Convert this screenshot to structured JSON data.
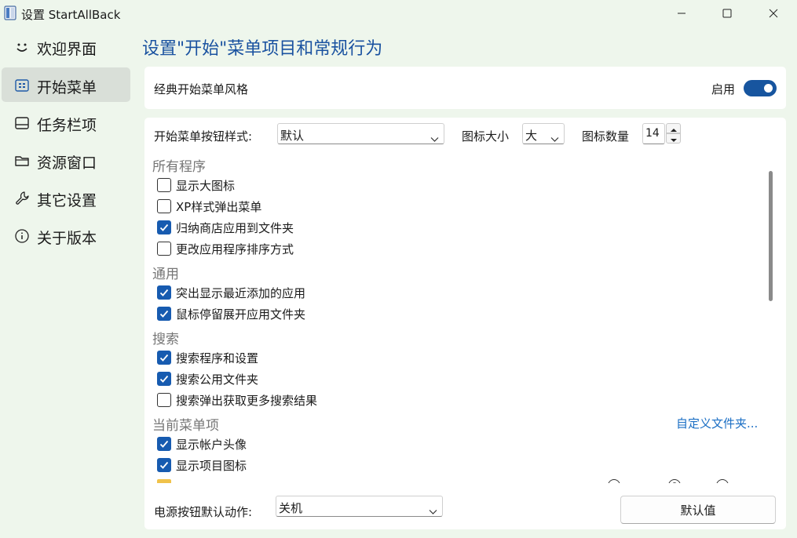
{
  "window": {
    "title": "设置 StartAllBack",
    "controls": [
      "minimize-icon",
      "maximize-icon",
      "close-icon"
    ]
  },
  "sidebar": {
    "items": [
      {
        "label": "欢迎界面",
        "icon": "smile-icon",
        "active": false
      },
      {
        "label": "开始菜单",
        "icon": "start-menu-icon",
        "active": true
      },
      {
        "label": "任务栏项",
        "icon": "taskbar-icon",
        "active": false
      },
      {
        "label": "资源窗口",
        "icon": "folder-icon",
        "active": false
      },
      {
        "label": "其它设置",
        "icon": "wrench-icon",
        "active": false
      },
      {
        "label": "关于版本",
        "icon": "info-icon",
        "active": false
      }
    ]
  },
  "main": {
    "title": "设置\"开始\"菜单项目和常规行为",
    "classic_style": {
      "label": "经典开始菜单风格",
      "toggle_label": "启用",
      "enabled": true
    },
    "options_row": {
      "button_style_label": "开始菜单按钮样式:",
      "button_style_value": "默认",
      "icon_size_label": "图标大小",
      "icon_size_value": "大",
      "icon_count_label": "图标数量",
      "icon_count_value": "14"
    },
    "sections": [
      {
        "title": "所有程序",
        "items": [
          {
            "label": "显示大图标",
            "checked": false
          },
          {
            "label": "XP样式弹出菜单",
            "checked": false
          },
          {
            "label": "归纳商店应用到文件夹",
            "checked": true
          },
          {
            "label": "更改应用程序排序方式",
            "checked": false
          }
        ]
      },
      {
        "title": "通用",
        "items": [
          {
            "label": "突出显示最近添加的应用",
            "checked": true
          },
          {
            "label": "鼠标停留展开应用文件夹",
            "checked": true
          }
        ]
      },
      {
        "title": "搜索",
        "items": [
          {
            "label": "搜索程序和设置",
            "checked": true
          },
          {
            "label": "搜索公用文件夹",
            "checked": true
          },
          {
            "label": "搜索弹出获取更多搜索结果",
            "checked": false
          }
        ]
      },
      {
        "title": "当前菜单项",
        "link": "自定义文件夹...",
        "items": [
          {
            "label": "显示帐户头像",
            "checked": true
          },
          {
            "label": "显示项目图标",
            "checked": true
          }
        ]
      }
    ],
    "power_button": {
      "label": "电源按钮默认动作:",
      "value": "关机"
    },
    "defaults_button": "默认值"
  },
  "colors": {
    "accent": "#17559f",
    "title": "#1a52a0",
    "link": "#1a6ec4",
    "background": "#eef6ec",
    "checkbox": "#175bb0"
  }
}
